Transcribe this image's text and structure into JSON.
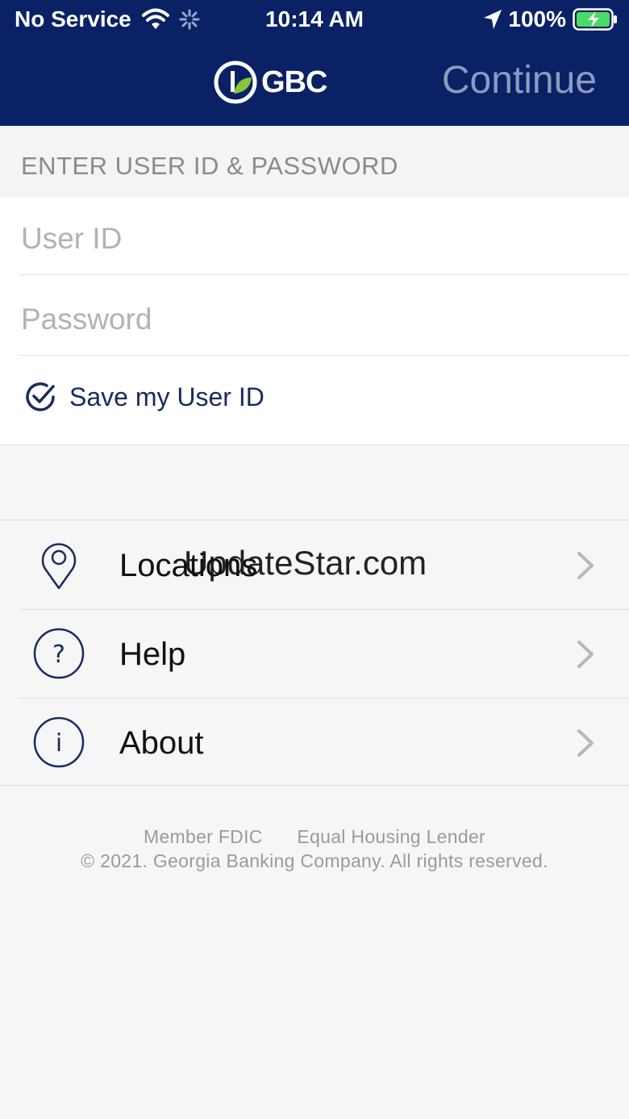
{
  "status_bar": {
    "carrier": "No Service",
    "time": "10:14 AM",
    "battery": "100%"
  },
  "nav": {
    "logo_text": "GBC",
    "continue_label": "Continue"
  },
  "form": {
    "section_title": "ENTER USER ID & PASSWORD",
    "user_id_placeholder": "User ID",
    "password_placeholder": "Password",
    "save_user_id_label": "Save my User ID"
  },
  "menu": {
    "items": [
      {
        "label": "Locations",
        "icon": "location-pin-icon"
      },
      {
        "label": "Help",
        "icon": "question-circle-icon"
      },
      {
        "label": "About",
        "icon": "info-circle-icon"
      }
    ]
  },
  "watermark": "UpdateStar.com",
  "footer": {
    "member": "Member FDIC",
    "lender": "Equal Housing Lender",
    "copyright": "© 2021. Georgia Banking Company. All rights reserved."
  },
  "colors": {
    "header_bg": "#0a2166",
    "continue_disabled": "#8c9bbf",
    "accent_navy": "#1a2a5e",
    "battery_green": "#4cd964",
    "logo_leaf": "#8bc53f"
  }
}
